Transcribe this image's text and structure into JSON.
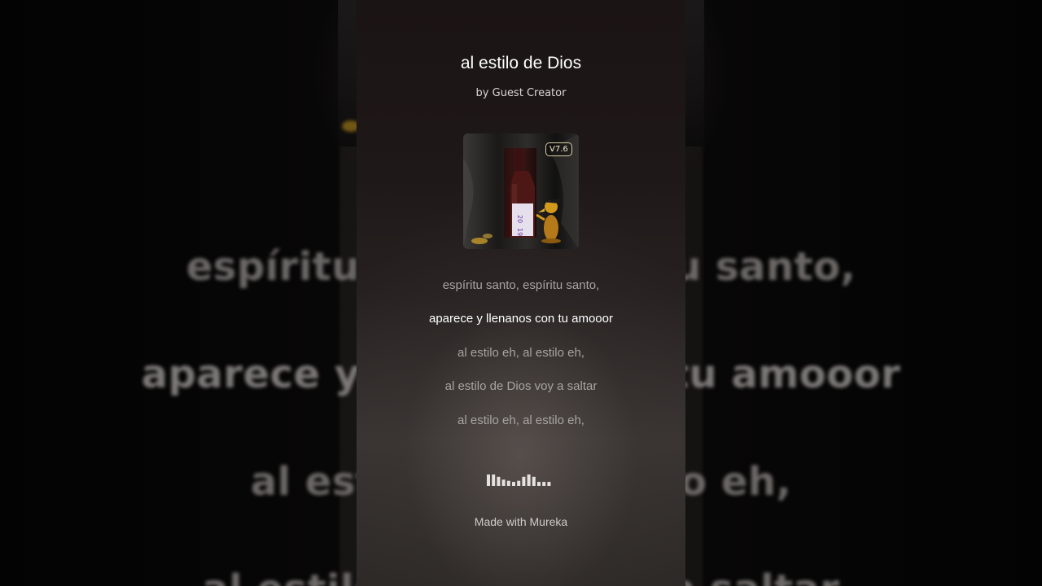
{
  "song": {
    "title": "al estilo de Dios",
    "artist": "by Guest Creator",
    "version_badge": "V7.6"
  },
  "lyrics": [
    {
      "text": "espíritu santo, espíritu santo,",
      "active": false
    },
    {
      "text": "aparece y llenanos con tu amooor",
      "active": true
    },
    {
      "text": "al estilo eh, al estilo eh,",
      "active": false
    },
    {
      "text": "al estilo de Dios voy a saltar",
      "active": false
    },
    {
      "text": "al estilo eh, al estilo eh,",
      "active": false
    }
  ],
  "background_lyrics": {
    "line_1": "espíritu santo, espíritu santo,",
    "line_2": "aparece y llenanos con tu amooor",
    "line_3": "al estilo eh, al estilo eh,",
    "line_4": "al estilo de Dios voy a saltar"
  },
  "waveform": {
    "levels": [
      1,
      1,
      0.8,
      0.55,
      0.45,
      0.35,
      0.45,
      0.8,
      1,
      0.8,
      0.35,
      0.35,
      0.35
    ]
  },
  "footer": {
    "watermark": "Made with Mureka"
  },
  "cover_art": {
    "bottle_label": "20 19"
  },
  "colors": {
    "active_lyric": "#ffffff",
    "inactive_lyric": "#a8a4a2",
    "badge_border": "#d8cfa6"
  }
}
